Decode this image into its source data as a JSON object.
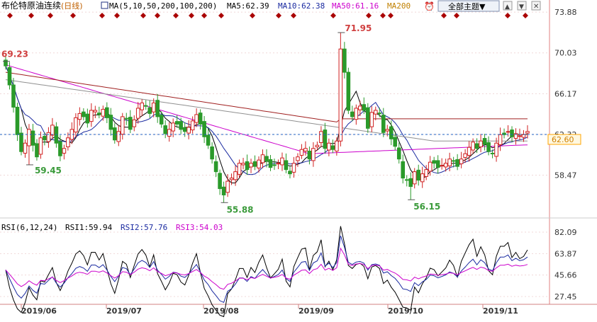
{
  "header": {
    "instrument": "布伦特原油连续",
    "period": "(日线)",
    "ma_label": "MA(5,10,50,200,100,200)",
    "ma5": "MA5:62.39",
    "ma10": "MA10:62.38",
    "ma50": "MA50:61.16",
    "ma200": "MA200",
    "theme_button": "全部主题▼"
  },
  "rsi_header": {
    "label": "RSI(6,12,24)",
    "rsi1": "RSI1:59.94",
    "rsi2": "RSI2:57.76",
    "rsi3": "RSI3:54.03"
  },
  "current_price_tag": "62.60",
  "peak_labels": {
    "high_left": "69.23",
    "high_mid": "71.95",
    "low1": "59.45",
    "low2": "55.88",
    "low3": "56.15"
  },
  "colors": {
    "up": "#d02020",
    "down": "#2a9a2a",
    "ma5": "#000000",
    "ma10": "#1a2aa0",
    "ma50": "#cc00cc",
    "ma100": "#909090",
    "ma200": "#a02020",
    "price_line": "#2060c0",
    "tag_bg": "#ffa500",
    "marker": "#aa0000"
  },
  "chart_data": [
    {
      "type": "candlestick",
      "title": "布伦特原油连续(日线)",
      "y_ticks": [
        "73.88",
        "70.03",
        "66.17",
        "62.32",
        "58.47"
      ],
      "x_ticks": [
        "2019/06",
        "2019/07",
        "2019/08",
        "2019/09",
        "2019/10",
        "2019/11"
      ],
      "ylim": [
        54.5,
        74.5
      ],
      "current_price": 62.6,
      "annotations": [
        {
          "label": "69.23",
          "value": 69.23
        },
        {
          "label": "71.95",
          "value": 71.95
        },
        {
          "label": "59.45",
          "value": 59.45
        },
        {
          "label": "55.88",
          "value": 55.88
        },
        {
          "label": "56.15",
          "value": 56.15
        }
      ],
      "close": [
        68.8,
        67.0,
        64.9,
        62.3,
        60.7,
        61.5,
        62.8,
        61.3,
        60.2,
        62.0,
        61.8,
        62.5,
        63.2,
        61.5,
        60.3,
        61.0,
        62.0,
        62.8,
        63.9,
        64.3,
        64.0,
        63.4,
        64.6,
        64.6,
        64.2,
        64.7,
        63.9,
        62.8,
        61.8,
        62.6,
        64.0,
        63.8,
        62.8,
        63.7,
        64.8,
        65.3,
        65.0,
        64.3,
        65.3,
        64.0,
        63.3,
        62.4,
        62.8,
        63.4,
        63.3,
        62.8,
        62.6,
        63.0,
        63.6,
        64.2,
        63.3,
        62.1,
        61.3,
        60.0,
        58.8,
        57.2,
        56.6,
        57.9,
        58.2,
        58.8,
        59.6,
        59.6,
        59.0,
        59.6,
        59.3,
        59.9,
        60.4,
        59.8,
        59.2,
        59.4,
        59.6,
        60.1,
        59.0,
        58.6,
        59.6,
        60.2,
        60.9,
        61.0,
        60.0,
        61.0,
        61.3,
        62.6,
        61.0,
        61.5,
        60.9,
        61.7,
        70.4,
        68.2,
        64.6,
        64.0,
        64.8,
        65.0,
        64.6,
        62.9,
        64.4,
        64.6,
        64.3,
        62.5,
        62.8,
        61.9,
        61.2,
        60.0,
        58.2,
        58.0,
        57.4,
        58.8,
        58.0,
        58.6,
        59.0,
        59.7,
        59.6,
        59.2,
        59.4,
        59.6,
        60.0,
        59.8,
        59.3,
        60.0,
        60.5,
        61.1,
        61.6,
        61.0,
        61.7,
        61.4,
        60.7,
        60.5,
        61.5,
        62.3,
        62.3,
        62.6,
        62.1,
        62.4,
        62.2,
        62.3,
        62.6
      ],
      "ma_series": [
        "MA5",
        "MA10",
        "MA50",
        "MA100",
        "MA200"
      ]
    },
    {
      "type": "line",
      "title": "RSI(6,12,24)",
      "y_ticks": [
        "82.09",
        "63.87",
        "45.66",
        "27.45"
      ],
      "ylim": [
        18,
        86
      ],
      "series": [
        {
          "name": "RSI1",
          "values": [
            59.94
          ]
        },
        {
          "name": "RSI2",
          "values": [
            57.76
          ]
        },
        {
          "name": "RSI3",
          "values": [
            54.03
          ]
        }
      ]
    }
  ]
}
